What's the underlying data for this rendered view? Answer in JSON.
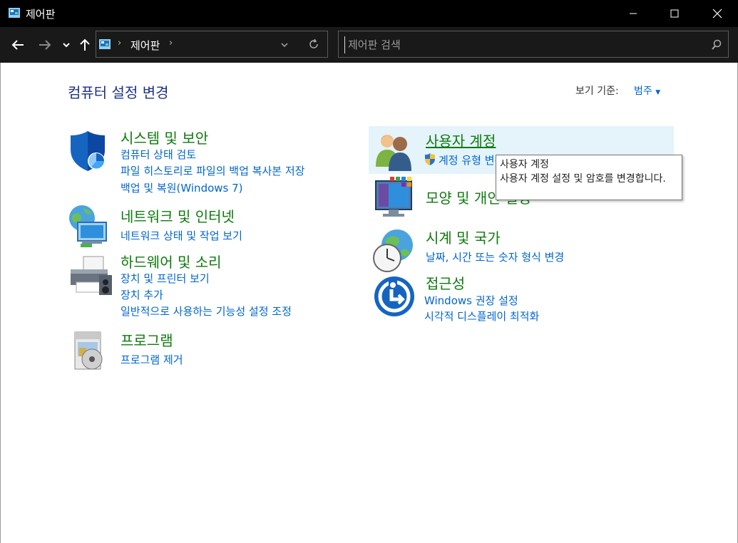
{
  "window": {
    "title": "제어판"
  },
  "address": {
    "location": "제어판"
  },
  "search": {
    "placeholder": "제어판 검색"
  },
  "main": {
    "heading": "컴퓨터 설정 변경",
    "view_by_label": "보기 기준:",
    "view_by_value": "범주"
  },
  "categories": {
    "system_security": {
      "title": "시스템 및 보안",
      "links": [
        "컴퓨터 상태 검토",
        "파일 히스토리로 파일의 백업 복사본 저장",
        "백업 및 복원(Windows 7)"
      ]
    },
    "network": {
      "title": "네트워크 및 인터넷",
      "links": [
        "네트워크 상태 및 작업 보기"
      ]
    },
    "hardware_sound": {
      "title": "하드웨어 및 소리",
      "links": [
        "장치 및 프린터 보기",
        "장치 추가",
        "일반적으로 사용하는 기능성 설정 조정"
      ]
    },
    "programs": {
      "title": "프로그램",
      "links": [
        "프로그램 제거"
      ]
    },
    "user_accounts": {
      "title": "사용자 계정",
      "links": [
        "계정 유형 변경"
      ]
    },
    "appearance": {
      "title": "모양 및 개인 설정"
    },
    "clock_region": {
      "title": "시계 및 국가",
      "links": [
        "날짜, 시간 또는 숫자 형식 변경"
      ]
    },
    "accessibility": {
      "title": "접근성",
      "links": [
        "Windows 권장 설정",
        "시각적 디스플레이 최적화"
      ]
    }
  },
  "tooltip": {
    "title": "사용자 계정",
    "text": "사용자 계정 설정 및 암호를 변경합니다."
  },
  "colors": {
    "titlebar": "#000000",
    "link": "#0066cc",
    "category": "#0e7a0d",
    "heading": "#1e3287",
    "hover": "#e5f3fb"
  }
}
